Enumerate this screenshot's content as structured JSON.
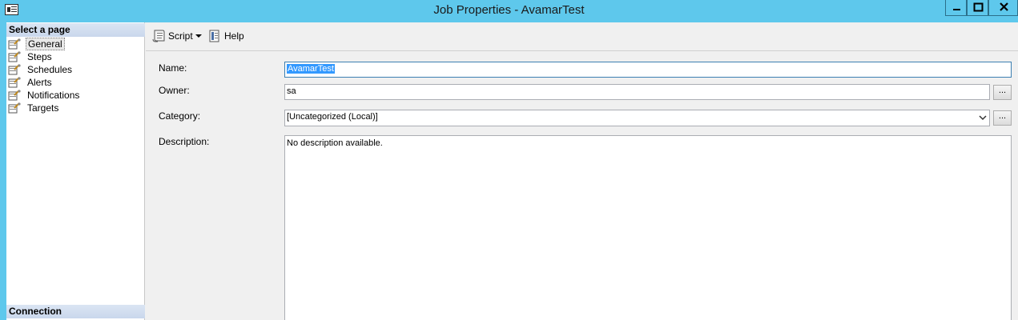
{
  "window": {
    "title": "Job Properties - AvamarTest"
  },
  "left_pane": {
    "select_header": "Select a page",
    "pages": [
      {
        "label": "General",
        "selected": true
      },
      {
        "label": "Steps",
        "selected": false
      },
      {
        "label": "Schedules",
        "selected": false
      },
      {
        "label": "Alerts",
        "selected": false
      },
      {
        "label": "Notifications",
        "selected": false
      },
      {
        "label": "Targets",
        "selected": false
      }
    ],
    "connection_header": "Connection"
  },
  "toolbar": {
    "script_label": "Script",
    "help_label": "Help"
  },
  "form": {
    "name_label": "Name:",
    "name_value": "AvamarTest",
    "owner_label": "Owner:",
    "owner_value": "sa",
    "owner_button": "...",
    "category_label": "Category:",
    "category_value": "[Uncategorized (Local)]",
    "category_button": "...",
    "description_label": "Description:",
    "description_value": "No description available."
  },
  "colors": {
    "titlebar": "#5ec8ec",
    "selection": "#3399ff",
    "window_bg": "#f0f0f0"
  }
}
